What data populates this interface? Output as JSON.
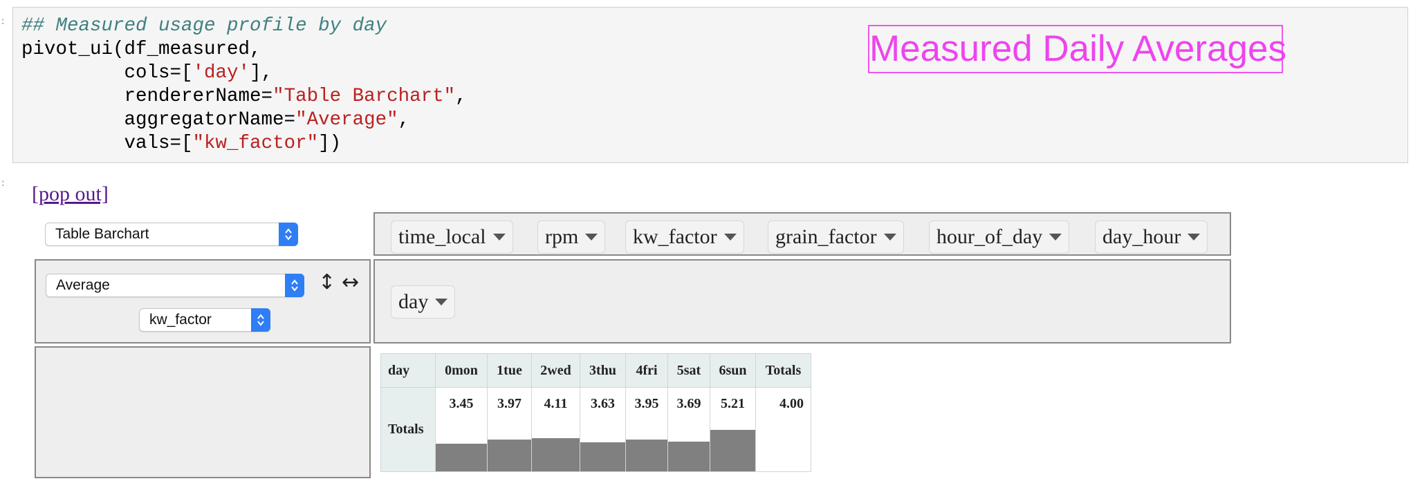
{
  "code": {
    "comment": "## Measured usage profile by day",
    "line2_a": "pivot_ui(df_measured,",
    "line3_a": "         cols=[",
    "line3_str": "'day'",
    "line3_b": "],",
    "line4_a": "         rendererName=",
    "line4_str": "\"Table Barchart\"",
    "line4_b": ",",
    "line5_a": "         aggregatorName=",
    "line5_str": "\"Average\"",
    "line5_b": ",",
    "line6_a": "         vals=[",
    "line6_str": "\"kw_factor\"",
    "line6_b": "])"
  },
  "overlay_title": "Measured Daily Averages",
  "output": {
    "popout_label": "[pop out]",
    "renderer": "Table Barchart",
    "aggregator": "Average",
    "value_field": "kw_factor",
    "sort_icon": "↕",
    "order_icon": "↔",
    "unused_attrs": [
      "time_local",
      "rpm",
      "kw_factor",
      "grain_factor",
      "hour_of_day",
      "day_hour"
    ],
    "col_attrs": [
      "day"
    ]
  },
  "colors": {
    "bar": "#808080",
    "overlay": "#ee44ee",
    "select_accent": "#2f7ef5"
  },
  "chart_data": {
    "type": "bar",
    "corner_label": "day",
    "row_label": "Totals",
    "categories": [
      "0mon",
      "1tue",
      "2wed",
      "3thu",
      "4fri",
      "5sat",
      "6sun"
    ],
    "values": [
      3.45,
      3.97,
      4.11,
      3.63,
      3.95,
      3.69,
      5.21
    ],
    "value_labels": [
      "3.45",
      "3.97",
      "4.11",
      "3.63",
      "3.95",
      "3.69",
      "5.21"
    ],
    "total_header": "Totals",
    "total_value": "4.00"
  }
}
